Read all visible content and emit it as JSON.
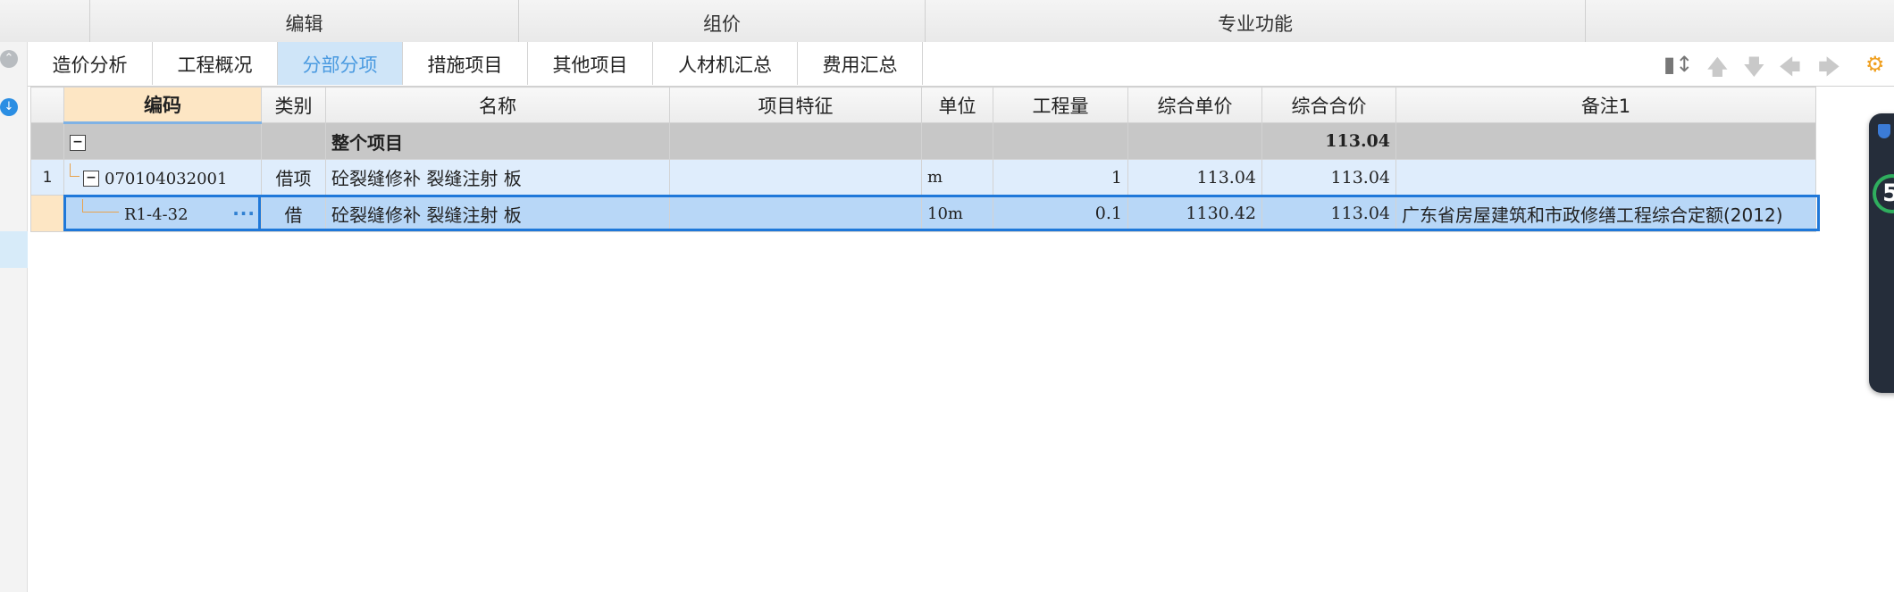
{
  "ribbon": {
    "groups": [
      {
        "label": "编辑"
      },
      {
        "label": "组价"
      },
      {
        "label": "专业功能"
      }
    ]
  },
  "tabs": [
    {
      "label": "造价分析",
      "active": false
    },
    {
      "label": "工程概况",
      "active": false
    },
    {
      "label": "分部分项",
      "active": true
    },
    {
      "label": "措施项目",
      "active": false
    },
    {
      "label": "其他项目",
      "active": false
    },
    {
      "label": "人材机汇总",
      "active": false
    },
    {
      "label": "费用汇总",
      "active": false
    }
  ],
  "toolbar_icons": [
    "column-split-icon",
    "arrow-up-icon",
    "arrow-down-icon",
    "arrow-left-icon",
    "arrow-right-icon",
    "settings-grid-icon"
  ],
  "table": {
    "headers": {
      "code": "编码",
      "type": "类别",
      "name": "名称",
      "feature": "项目特征",
      "unit": "单位",
      "qty": "工程量",
      "unit_price": "综合单价",
      "total_price": "综合合价",
      "remark": "备注1"
    },
    "total_row": {
      "expander": "−",
      "name": "整个项目",
      "total_price": "113.04"
    },
    "rows": [
      {
        "rowno": "1",
        "expander": "−",
        "code": "070104032001",
        "type": "借项",
        "name": "砼裂缝修补 裂缝注射 板",
        "feature": "",
        "unit": "m",
        "qty": "1",
        "unit_price": "113.04",
        "total_price": "113.04",
        "remark": ""
      },
      {
        "rowno": "",
        "code": "R1-4-32",
        "more": "···",
        "type": "借",
        "name": "砼裂缝修补 裂缝注射 板",
        "feature": "",
        "unit": "10m",
        "qty": "0.1",
        "unit_price": "1130.42",
        "total_price": "113.04",
        "remark": "广东省房屋建筑和市政修缮工程综合定额(2012)"
      }
    ]
  },
  "widget": {
    "score": "5"
  },
  "colors": {
    "accent": "#1f78d9",
    "active_tab_bg": "#cfe5f8",
    "active_tab_text": "#4a9ae0",
    "total_row_bg": "#c7c7c7",
    "selected_row_bg": "#b8d7f7"
  }
}
